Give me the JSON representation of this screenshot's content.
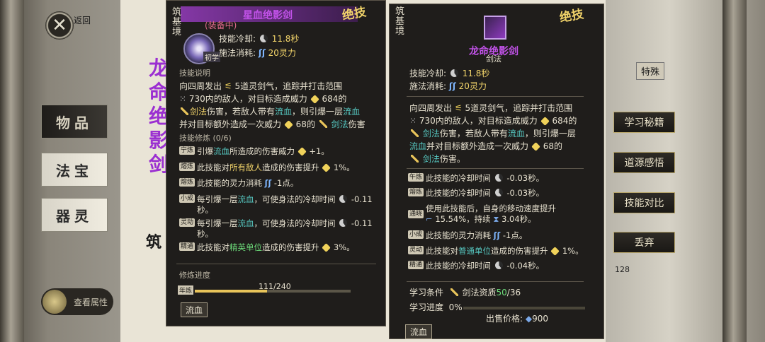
{
  "nav": {
    "back_label": "返回",
    "tabs": [
      "物品",
      "法宝",
      "器灵"
    ],
    "view_attr": "查看属性"
  },
  "background": {
    "title_chars": [
      "龙",
      "命",
      "绝",
      "影",
      "剑"
    ],
    "realm_fragment": "筑",
    "right_tab": "特殊",
    "right_level": "128"
  },
  "right_menu": [
    "学习秘籍",
    "道源感悟",
    "技能对比",
    "丢弃"
  ],
  "left_panel": {
    "realm": "筑基境",
    "jueji": "绝技",
    "name": "星血绝影剑",
    "equipped": "(装备中)",
    "grade": "初学",
    "cooldown_label": "技能冷却:",
    "cooldown_value": "11.8秒",
    "cost_label": "施法消耗:",
    "cost_value": "20灵力",
    "desc_header": "技能说明",
    "desc": {
      "l1a": "向四周发出",
      "l1b": "5道灵剑气，追踪并打击范围",
      "l2a": "730内的敌人，对目标造成威力",
      "l2b": "684的",
      "l3a": "剑法",
      "l3b": "伤害，若敌人带有",
      "l3c": "流血",
      "l3d": "，则引爆一层",
      "l3e": "流血",
      "l4a": "并对目标额外造成一次威力",
      "l4b": "68的",
      "l4c": "剑法",
      "l4d": "伤害"
    },
    "train_header": "技能修炼 (0/6)",
    "mods": [
      {
        "tag": "宁炼",
        "a": "引爆",
        "b": "流血",
        "c": "所造成的伤害威力",
        "d": "+1。"
      },
      {
        "tag": "熔炼",
        "a": "此技能对",
        "b": "所有敌人",
        "c": "造成的伤害提升",
        "d": "1%。"
      },
      {
        "tag": "熔炼",
        "a": "此技能的灵力消耗",
        "b": "",
        "c": "",
        "d": "-1点。"
      },
      {
        "tag": "小成",
        "a": "每引爆一层",
        "b": "流血",
        "c": "，可使身法的冷却时间",
        "d": "-0.11秒。"
      },
      {
        "tag": "灵动",
        "a": "每引爆一层",
        "b": "流血",
        "c": "，可使身法的冷却时间",
        "d": "-0.11秒。"
      },
      {
        "tag": "精通",
        "a": "此技能对",
        "b": "精英单位",
        "c": "造成的伤害提升",
        "d": "3%。"
      }
    ],
    "progress_label": "修炼进度",
    "progress_text": "111/240",
    "progress_value": 0.4625,
    "progress_tag": "年炼",
    "bleed_button": "流血"
  },
  "right_panel": {
    "realm": "筑基境",
    "jueji": "绝技",
    "name": "龙命绝影剑",
    "type": "剑法",
    "cooldown_label": "技能冷却:",
    "cooldown_value": "11.8秒",
    "cost_label": "施法消耗:",
    "cost_value": "20灵力",
    "desc": {
      "l1a": "向四周发出",
      "l1b": "5道灵剑气，追踪并打击范围",
      "l2a": "730内的敌人，对目标造成威力",
      "l2b": "684的",
      "l3a": "剑法",
      "l3b": "伤害，若敌人带有",
      "l3c": "流血",
      "l3d": "，则引爆一层",
      "l4a": "流血",
      "l4b": "并对目标额外造成一次威力",
      "l4c": "68的",
      "l5a": "剑法",
      "l5b": "伤害。"
    },
    "mods": [
      {
        "tag": "午炼",
        "text": "此技能的冷却时间",
        "val": "-0.03秒。"
      },
      {
        "tag": "熔炼",
        "text": "此技能的冷却时间",
        "val": "-0.03秒。"
      },
      {
        "tag": "通晓",
        "text": "使用此技能后，自身的移动速度提升",
        "val": "15.54%，持续",
        "val2": "3.04秒。"
      },
      {
        "tag": "小成",
        "text": "此技能的灵力消耗",
        "val": "-1点。"
      },
      {
        "tag": "灵动",
        "text": "此技能对",
        "hl": "普通单位",
        "text2": "造成的伤害提升",
        "val": "1%。"
      },
      {
        "tag": "精通",
        "text": "此技能的冷却时间",
        "val": "-0.04秒。"
      }
    ],
    "req_label": "学习条件",
    "req_text": "剑法资质",
    "req_have": "50",
    "req_need": "/36",
    "learn_label": "学习进度",
    "learn_value": "0%",
    "price_label": "出售价格:",
    "price_value": "900",
    "bleed_button": "流血"
  }
}
